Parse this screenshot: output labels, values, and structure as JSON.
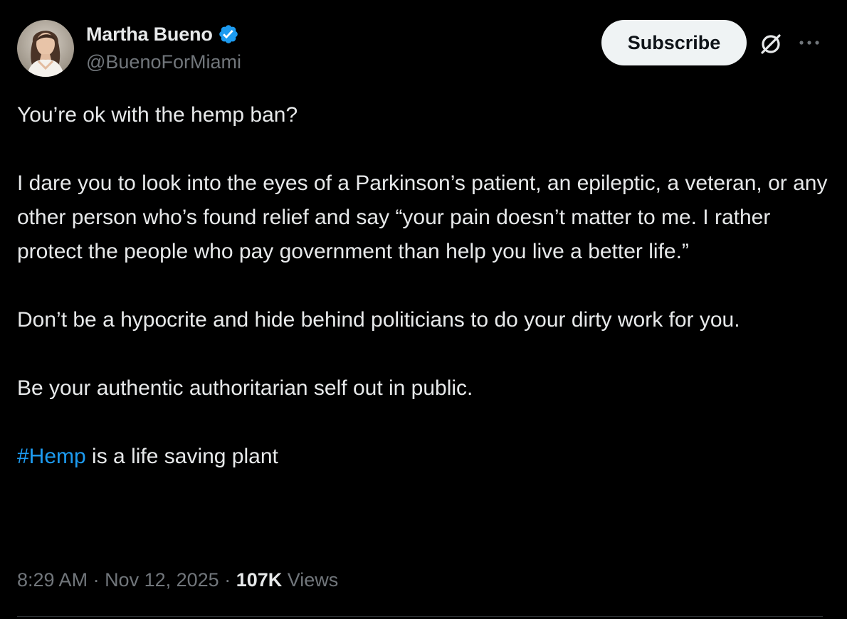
{
  "author": {
    "name": "Martha Bueno",
    "handle": "@BuenoForMiami",
    "verified": true
  },
  "actions": {
    "subscribe_label": "Subscribe"
  },
  "icons": {
    "verified": "verified-badge-icon",
    "grok": "grok-icon",
    "more": "more-options-icon"
  },
  "tweet": {
    "paragraphs": [
      "You’re ok with the hemp ban?",
      "I dare you to look into the eyes of a Parkinson’s patient, an epileptic, a veteran, or any other person who’s found relief and say “your pain doesn’t matter to me. I rather protect the people who pay government than help you live a better life.”",
      "Don’t be a hypocrite and hide behind politicians to do your dirty work for you.",
      "Be your authentic authoritarian self out in public."
    ],
    "hashtag": "#Hemp",
    "hashtag_suffix": " is a life saving plant"
  },
  "meta": {
    "time": "8:29 AM",
    "separator": " · ",
    "date": "Nov 12, 2025",
    "views_count": "107K",
    "views_label": " Views"
  },
  "colors": {
    "background": "#000000",
    "text": "#e7e9ea",
    "secondary_text": "#71767b",
    "link": "#1d9bf0",
    "verified_badge": "#1d9bf0",
    "button_bg": "#eff3f4",
    "button_text": "#0f1419"
  }
}
